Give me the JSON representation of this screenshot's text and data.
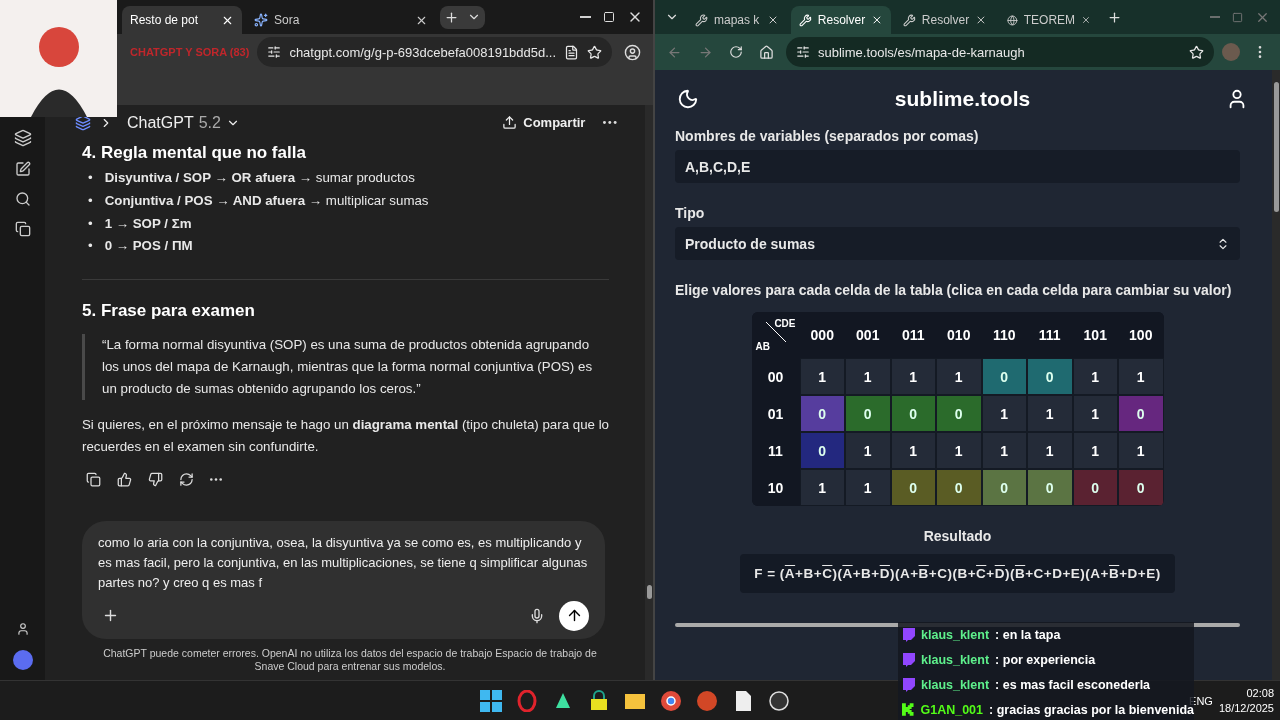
{
  "left_window": {
    "tabs": [
      {
        "label": "Resto de pot",
        "selected": true
      },
      {
        "label": "Sora",
        "selected": false
      }
    ],
    "tab_group": "CHATGPT Y SORA (83)",
    "url": "chatgpt.com/g/g-p-693dcebefa008191bdd5d...",
    "header": {
      "model": "ChatGPT",
      "version": "5.2",
      "share": "Compartir"
    },
    "section4": {
      "heading": "4. Regla mental que no falla",
      "bullets": [
        {
          "marker": "•",
          "text": "**Disyuntiva / SOP → OR afuera** → sumar productos"
        },
        {
          "marker": "•",
          "text": "**Conjuntiva / POS → AND afuera** → multiplicar sumas"
        },
        {
          "marker": "•",
          "text": "**1 → SOP / Σm**"
        },
        {
          "marker": "•",
          "text": "**0 → POS / ΠM**"
        }
      ]
    },
    "section5": {
      "heading": "5. Frase para examen",
      "quote": "“La forma normal disyuntiva (SOP) es una suma de productos obtenida agrupando los unos del mapa de Karnaugh, mientras que la forma normal conjuntiva (POS) es un producto de sumas obtenido agrupando los ceros.”",
      "followup": "Si quieres, en el próximo mensaje te hago un **diagrama mental** (tipo chuleta) para que lo recuerdes en el examen sin confundirte."
    },
    "composer": {
      "value": "como lo aria con la conjuntiva, osea, la disyuntiva ya se como es, es multiplicando y es mas facil, pero la conjuntiva, en las multiplicaciones, se tiene q simplificar algunas partes no? y creo q es mas f"
    },
    "disclaimer": "ChatGPT puede cometer errores. OpenAI no utiliza los datos del espacio de trabajo Espacio de trabajo de Snave Cloud para entrenar sus modelos."
  },
  "right_window": {
    "tabs": [
      {
        "label": "mapas k",
        "selected": false
      },
      {
        "label": "Resolver",
        "selected": true
      },
      {
        "label": "Resolver",
        "selected": false
      },
      {
        "label": "TEOREM",
        "selected": false
      }
    ],
    "url": "sublime.tools/es/mapa-de-karnaugh",
    "site_title": "sublime.tools",
    "variables": {
      "label": "Nombres de variables (separados por comas)",
      "value": "A,B,C,D,E"
    },
    "type": {
      "label": "Tipo",
      "value": "Producto de sumas"
    },
    "instruction": "Elige valores para cada celda de la tabla (clica en cada celda para cambiar su valor)",
    "kmap": {
      "col_var": "CDE",
      "row_var": "AB",
      "columns": [
        "000",
        "001",
        "011",
        "010",
        "110",
        "111",
        "101",
        "100"
      ],
      "rows": [
        {
          "label": "00",
          "cells": [
            {
              "value": "1"
            },
            {
              "value": "1"
            },
            {
              "value": "1"
            },
            {
              "value": "1"
            },
            {
              "value": "0",
              "color": "#1f6a70"
            },
            {
              "value": "0",
              "color": "#1f6a70"
            },
            {
              "value": "1"
            },
            {
              "value": "1"
            }
          ]
        },
        {
          "label": "01",
          "cells": [
            {
              "value": "0",
              "color": "#563d9e"
            },
            {
              "value": "0",
              "color": "#2b6b2b"
            },
            {
              "value": "0",
              "color": "#2b6b2b"
            },
            {
              "value": "0",
              "color": "#2b6b2b"
            },
            {
              "value": "1"
            },
            {
              "value": "1"
            },
            {
              "value": "1"
            },
            {
              "value": "0",
              "color": "#66277f"
            }
          ]
        },
        {
          "label": "11",
          "cells": [
            {
              "value": "0",
              "color": "#23287f"
            },
            {
              "value": "1"
            },
            {
              "value": "1"
            },
            {
              "value": "1"
            },
            {
              "value": "1"
            },
            {
              "value": "1"
            },
            {
              "value": "1"
            },
            {
              "value": "1"
            }
          ]
        },
        {
          "label": "10",
          "cells": [
            {
              "value": "1"
            },
            {
              "value": "1"
            },
            {
              "value": "0",
              "color": "#5a5c24"
            },
            {
              "value": "0",
              "color": "#5a5c24"
            },
            {
              "value": "0",
              "color": "#5b7443"
            },
            {
              "value": "0",
              "color": "#5b7443"
            },
            {
              "value": "0",
              "color": "#5a2231"
            },
            {
              "value": "0",
              "color": "#5a2231"
            }
          ]
        }
      ]
    },
    "result": {
      "label": "Resultado",
      "tokens": [
        {
          "text": "F = ("
        },
        {
          "text": "A",
          "negated": true
        },
        {
          "text": "+B+"
        },
        {
          "text": "C",
          "negated": true
        },
        {
          "text": ")("
        },
        {
          "text": "A",
          "negated": true
        },
        {
          "text": "+B+"
        },
        {
          "text": "D",
          "negated": true
        },
        {
          "text": ")(A+"
        },
        {
          "text": "B",
          "negated": true
        },
        {
          "text": "+C)(B+"
        },
        {
          "text": "C",
          "negated": true
        },
        {
          "text": "+"
        },
        {
          "text": "D",
          "negated": true
        },
        {
          "text": ")("
        },
        {
          "text": "B",
          "negated": true
        },
        {
          "text": "+C+D+E)(A+"
        },
        {
          "text": "B",
          "negated": true
        },
        {
          "text": "+D+E)"
        }
      ]
    }
  },
  "stream_chat": [
    {
      "kind": "twitch",
      "user": "klaus_klent",
      "sep": ":",
      "text": "en la tapa",
      "color": "#5ef08c"
    },
    {
      "kind": "twitch",
      "user": "klaus_klent",
      "sep": ":",
      "text": "por experiencia",
      "color": "#5ef08c"
    },
    {
      "kind": "twitch",
      "user": "klaus_klent",
      "sep": ":",
      "text": "es mas facil esconederla",
      "color": "#5ef08c"
    },
    {
      "kind": "kick",
      "user": "G1AN_001",
      "sep": ":",
      "text": "gracias gracias por la bienvenida",
      "color": "#53fc18"
    }
  ],
  "tray": {
    "language": "ENG",
    "time": "02:08",
    "date": "18/12/2025"
  }
}
